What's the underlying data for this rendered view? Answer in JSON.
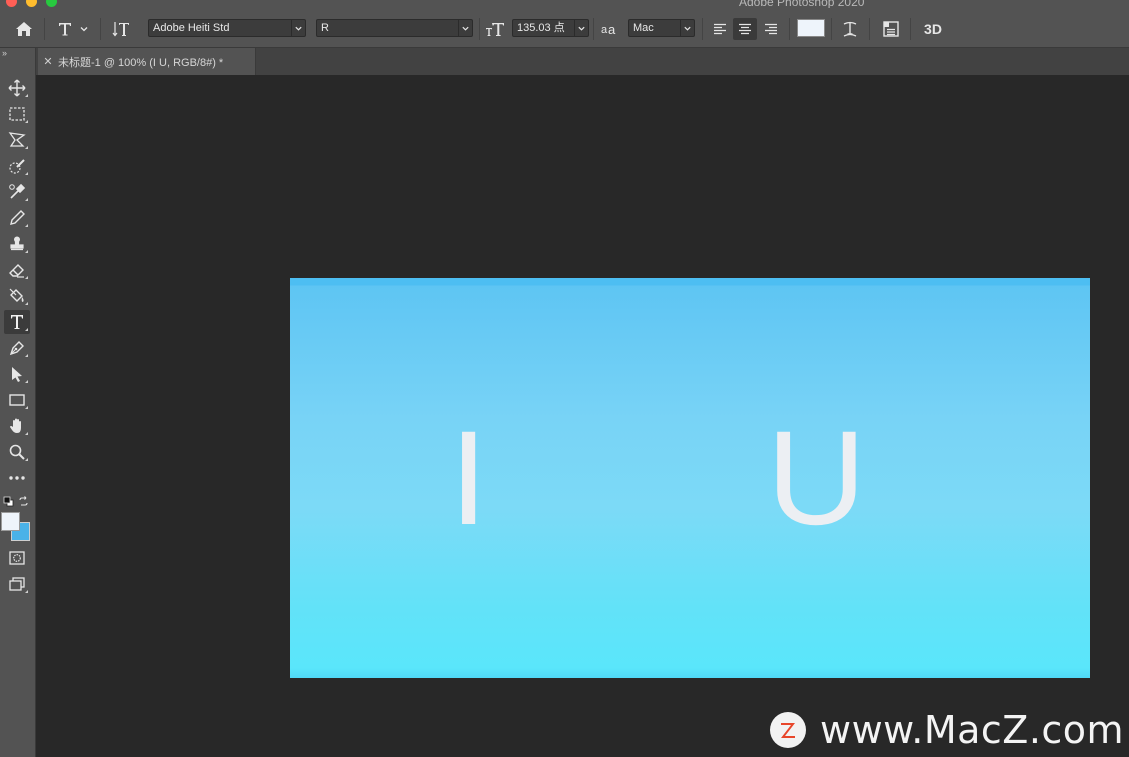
{
  "app": {
    "title": "Adobe Photoshop 2020"
  },
  "options_bar": {
    "font_family": "Adobe Heiti Std",
    "font_style": "R",
    "font_size": "135.03 点",
    "antialias": "Mac",
    "text_color": "#eef4fb",
    "threed_label": "3D"
  },
  "document_tab": {
    "title": "未标题-1 @ 100% (I     U, RGB/8#) *"
  },
  "tools": [
    "move-tool",
    "marquee-tool",
    "lasso-tool",
    "quick-selection-tool",
    "eyedropper-tool",
    "brush-tool",
    "stamp-tool",
    "eraser-tool",
    "paint-bucket-tool",
    "type-tool",
    "pen-tool",
    "path-selection-tool",
    "rectangle-tool",
    "hand-tool",
    "zoom-tool",
    "more-tools"
  ],
  "colors": {
    "foreground": "#eef4fb",
    "background": "#4ab2e8",
    "accent": "#53c2f3"
  },
  "canvas": {
    "text_left": "I",
    "text_right": "U"
  },
  "watermark": {
    "text": "www.MacZ.com",
    "logo_letter": "Z"
  }
}
